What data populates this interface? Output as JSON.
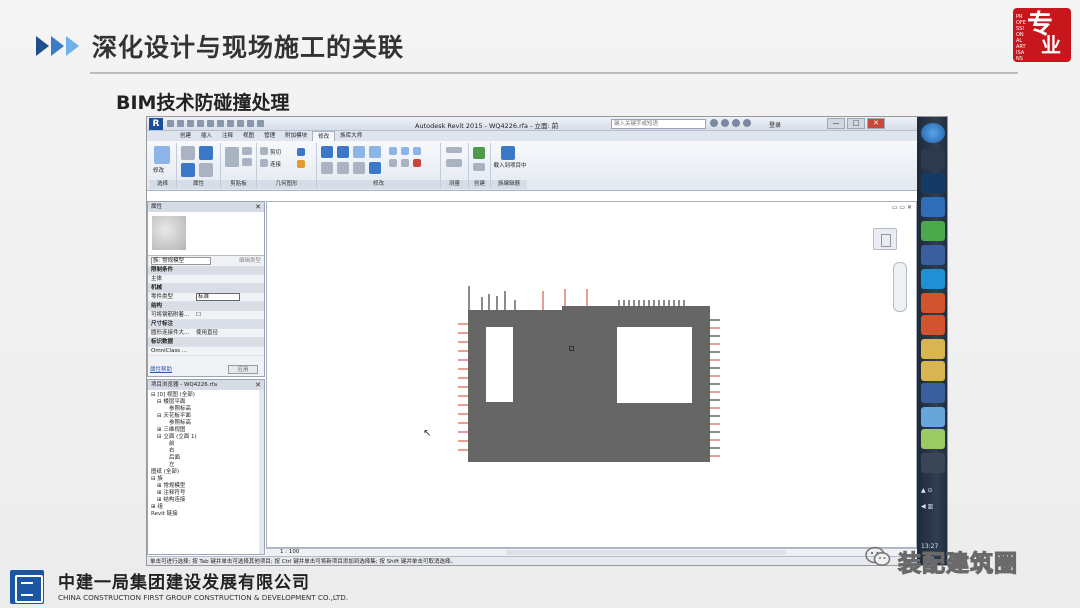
{
  "slide": {
    "title": "深化设计与现场施工的关联",
    "subtitle": "BIM技术防碰撞处理",
    "seal": {
      "big": "专",
      "big2": "业",
      "small": "PROFESSIONAL ARTISANS",
      "color": "#c8161d"
    }
  },
  "revit": {
    "app_title": "Autodesk Revit 2015 - WQ4226.rfa - 立面: 前",
    "search_placeholder": "键入关键字或短语",
    "login_label": "登录",
    "win_min": "—",
    "win_max": "□",
    "win_close": "✕",
    "ribbon_tabs": [
      "创建",
      "插入",
      "注释",
      "视图",
      "管理",
      "附加模块",
      "修改",
      "族库大师"
    ],
    "ribbon_active_tab": "修改",
    "ribbon_groups": [
      "选择",
      "属性",
      "剪贴板",
      "几何图形",
      "修改",
      "测量",
      "创建",
      "族编辑器"
    ],
    "ribbon_texts": {
      "modify": "修改",
      "cut": "剪切",
      "join": "连接",
      "load_into_project": "载入到项目中"
    },
    "properties": {
      "title": "属性",
      "type_selector": "族: 常规模型",
      "edit_type": "编辑类型",
      "rows": [
        {
          "label": "限制条件",
          "category": true
        },
        {
          "label": "主体",
          "value": ""
        },
        {
          "label": "机械",
          "category": true
        },
        {
          "label": "零件类型",
          "value": "标准",
          "boxed": true
        },
        {
          "label": "结构",
          "category": true
        },
        {
          "label": "可将钢筋附着...",
          "value": "☐"
        },
        {
          "label": "尺寸标注",
          "category": true
        },
        {
          "label": "圆形连接件大...",
          "value": "使用直径"
        },
        {
          "label": "标识数据",
          "category": true
        },
        {
          "label": "OmniClass ...",
          "value": ""
        }
      ],
      "help_link": "属性帮助",
      "apply_label": "应用"
    },
    "project_browser": {
      "title": "项目浏览器 - WQ4226.rfa",
      "items": [
        {
          "indent": 0,
          "label": "⊟ [0] 视图 (全部)"
        },
        {
          "indent": 1,
          "label": "⊟ 楼层平面"
        },
        {
          "indent": 3,
          "label": "参照标高"
        },
        {
          "indent": 1,
          "label": "⊟ 天花板平面"
        },
        {
          "indent": 3,
          "label": "参照标高"
        },
        {
          "indent": 1,
          "label": "⊞ 三维视图"
        },
        {
          "indent": 1,
          "label": "⊟ 立面 (立面 1)"
        },
        {
          "indent": 3,
          "label": "前"
        },
        {
          "indent": 3,
          "label": "右"
        },
        {
          "indent": 3,
          "label": "后面"
        },
        {
          "indent": 3,
          "label": "左"
        },
        {
          "indent": 0,
          "label": "图纸 (全部)"
        },
        {
          "indent": 0,
          "label": "⊟ 族"
        },
        {
          "indent": 1,
          "label": "⊞ 常规模型"
        },
        {
          "indent": 1,
          "label": "⊞ 注释符号"
        },
        {
          "indent": 1,
          "label": "⊞ 结构连接"
        },
        {
          "indent": 0,
          "label": "⊞ 组"
        },
        {
          "indent": 0,
          "label": "Revit 链接"
        }
      ]
    },
    "view_scale": "1 : 100",
    "view_controls": "▭ ▭ ✕",
    "status_text": "单击可进行选择; 按 Tab 键并单击可选择其他项目; 按 Ctrl 键并单击可将新项目添加到选择集; 按 Shift 键并单击可取消选择。",
    "clock": "13:27",
    "panel_close": "✕",
    "cursor": "↖"
  },
  "footer": {
    "company_cn": "中建一局集团建设发展有限公司",
    "company_en": "CHINA CONSTRUCTION FIRST GROUP CONSTRUCTION & DEVELOPMENT CO.,LTD.",
    "watermark": "装配建筑圈"
  },
  "colors": {
    "panel": "#666666",
    "rebar_black": "#1a1a1a",
    "rebar_red": "#d23b2f",
    "accent_blue": "#1f4e8c"
  }
}
